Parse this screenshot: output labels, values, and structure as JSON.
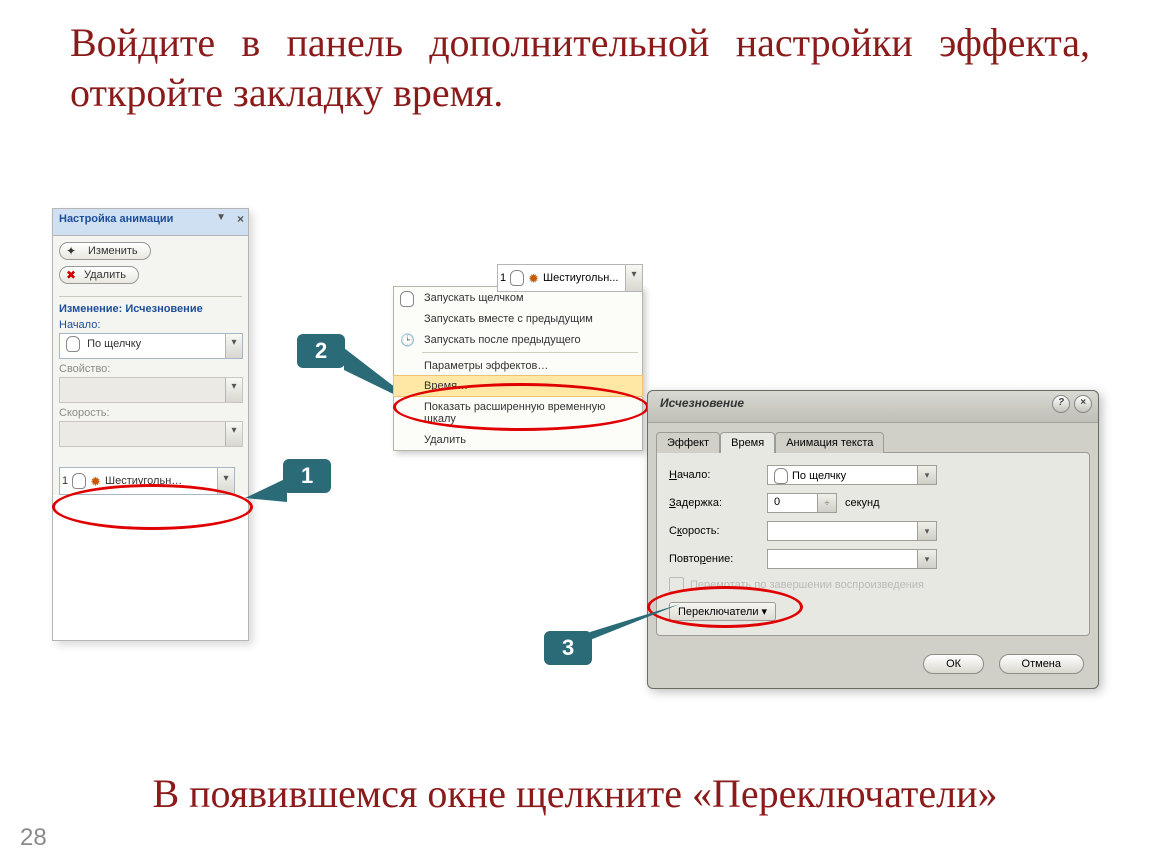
{
  "title_text": "Войдите в панель дополнительной настройки эффекта, откройте закладку время.",
  "footer_text": "В появившемся окне щелкните «Переключатели»",
  "page_number": "28",
  "anim_pane": {
    "title": "Настройка анимации",
    "btn_change": "Изменить",
    "btn_delete": "Удалить",
    "section": "Изменение: Исчезновение",
    "lbl_start": "Начало:",
    "val_start": "По щелчку",
    "lbl_property": "Свойство:",
    "lbl_speed": "Скорость:",
    "list_item_num": "1",
    "list_item_text": "Шестиугольн…"
  },
  "callouts": {
    "c1": "1",
    "c2": "2",
    "c3": "3"
  },
  "context_menu": {
    "header_num": "1",
    "header_text": "Шестиугольн...",
    "items": [
      "Запускать щелчком",
      "Запускать вместе с предыдущим",
      "Запускать после предыдущего",
      "Параметры эффектов…",
      "Время…",
      "Показать расширенную временную шкалу",
      "Удалить"
    ]
  },
  "dialog": {
    "title": "Исчезновение",
    "tabs": {
      "t1": "Эффект",
      "t2": "Время",
      "t3": "Анимация текста"
    },
    "lbl_start": "Начало:",
    "val_start": "По щелчку",
    "lbl_delay": "Задержка:",
    "val_delay": "0",
    "unit_delay": "секунд",
    "lbl_speed": "Скорость:",
    "lbl_repeat": "Повторение:",
    "chk_rewind": "Перемотать по завершении воспроизведения",
    "toggler": "Переключатели",
    "ok": "ОК",
    "cancel": "Отмена"
  }
}
